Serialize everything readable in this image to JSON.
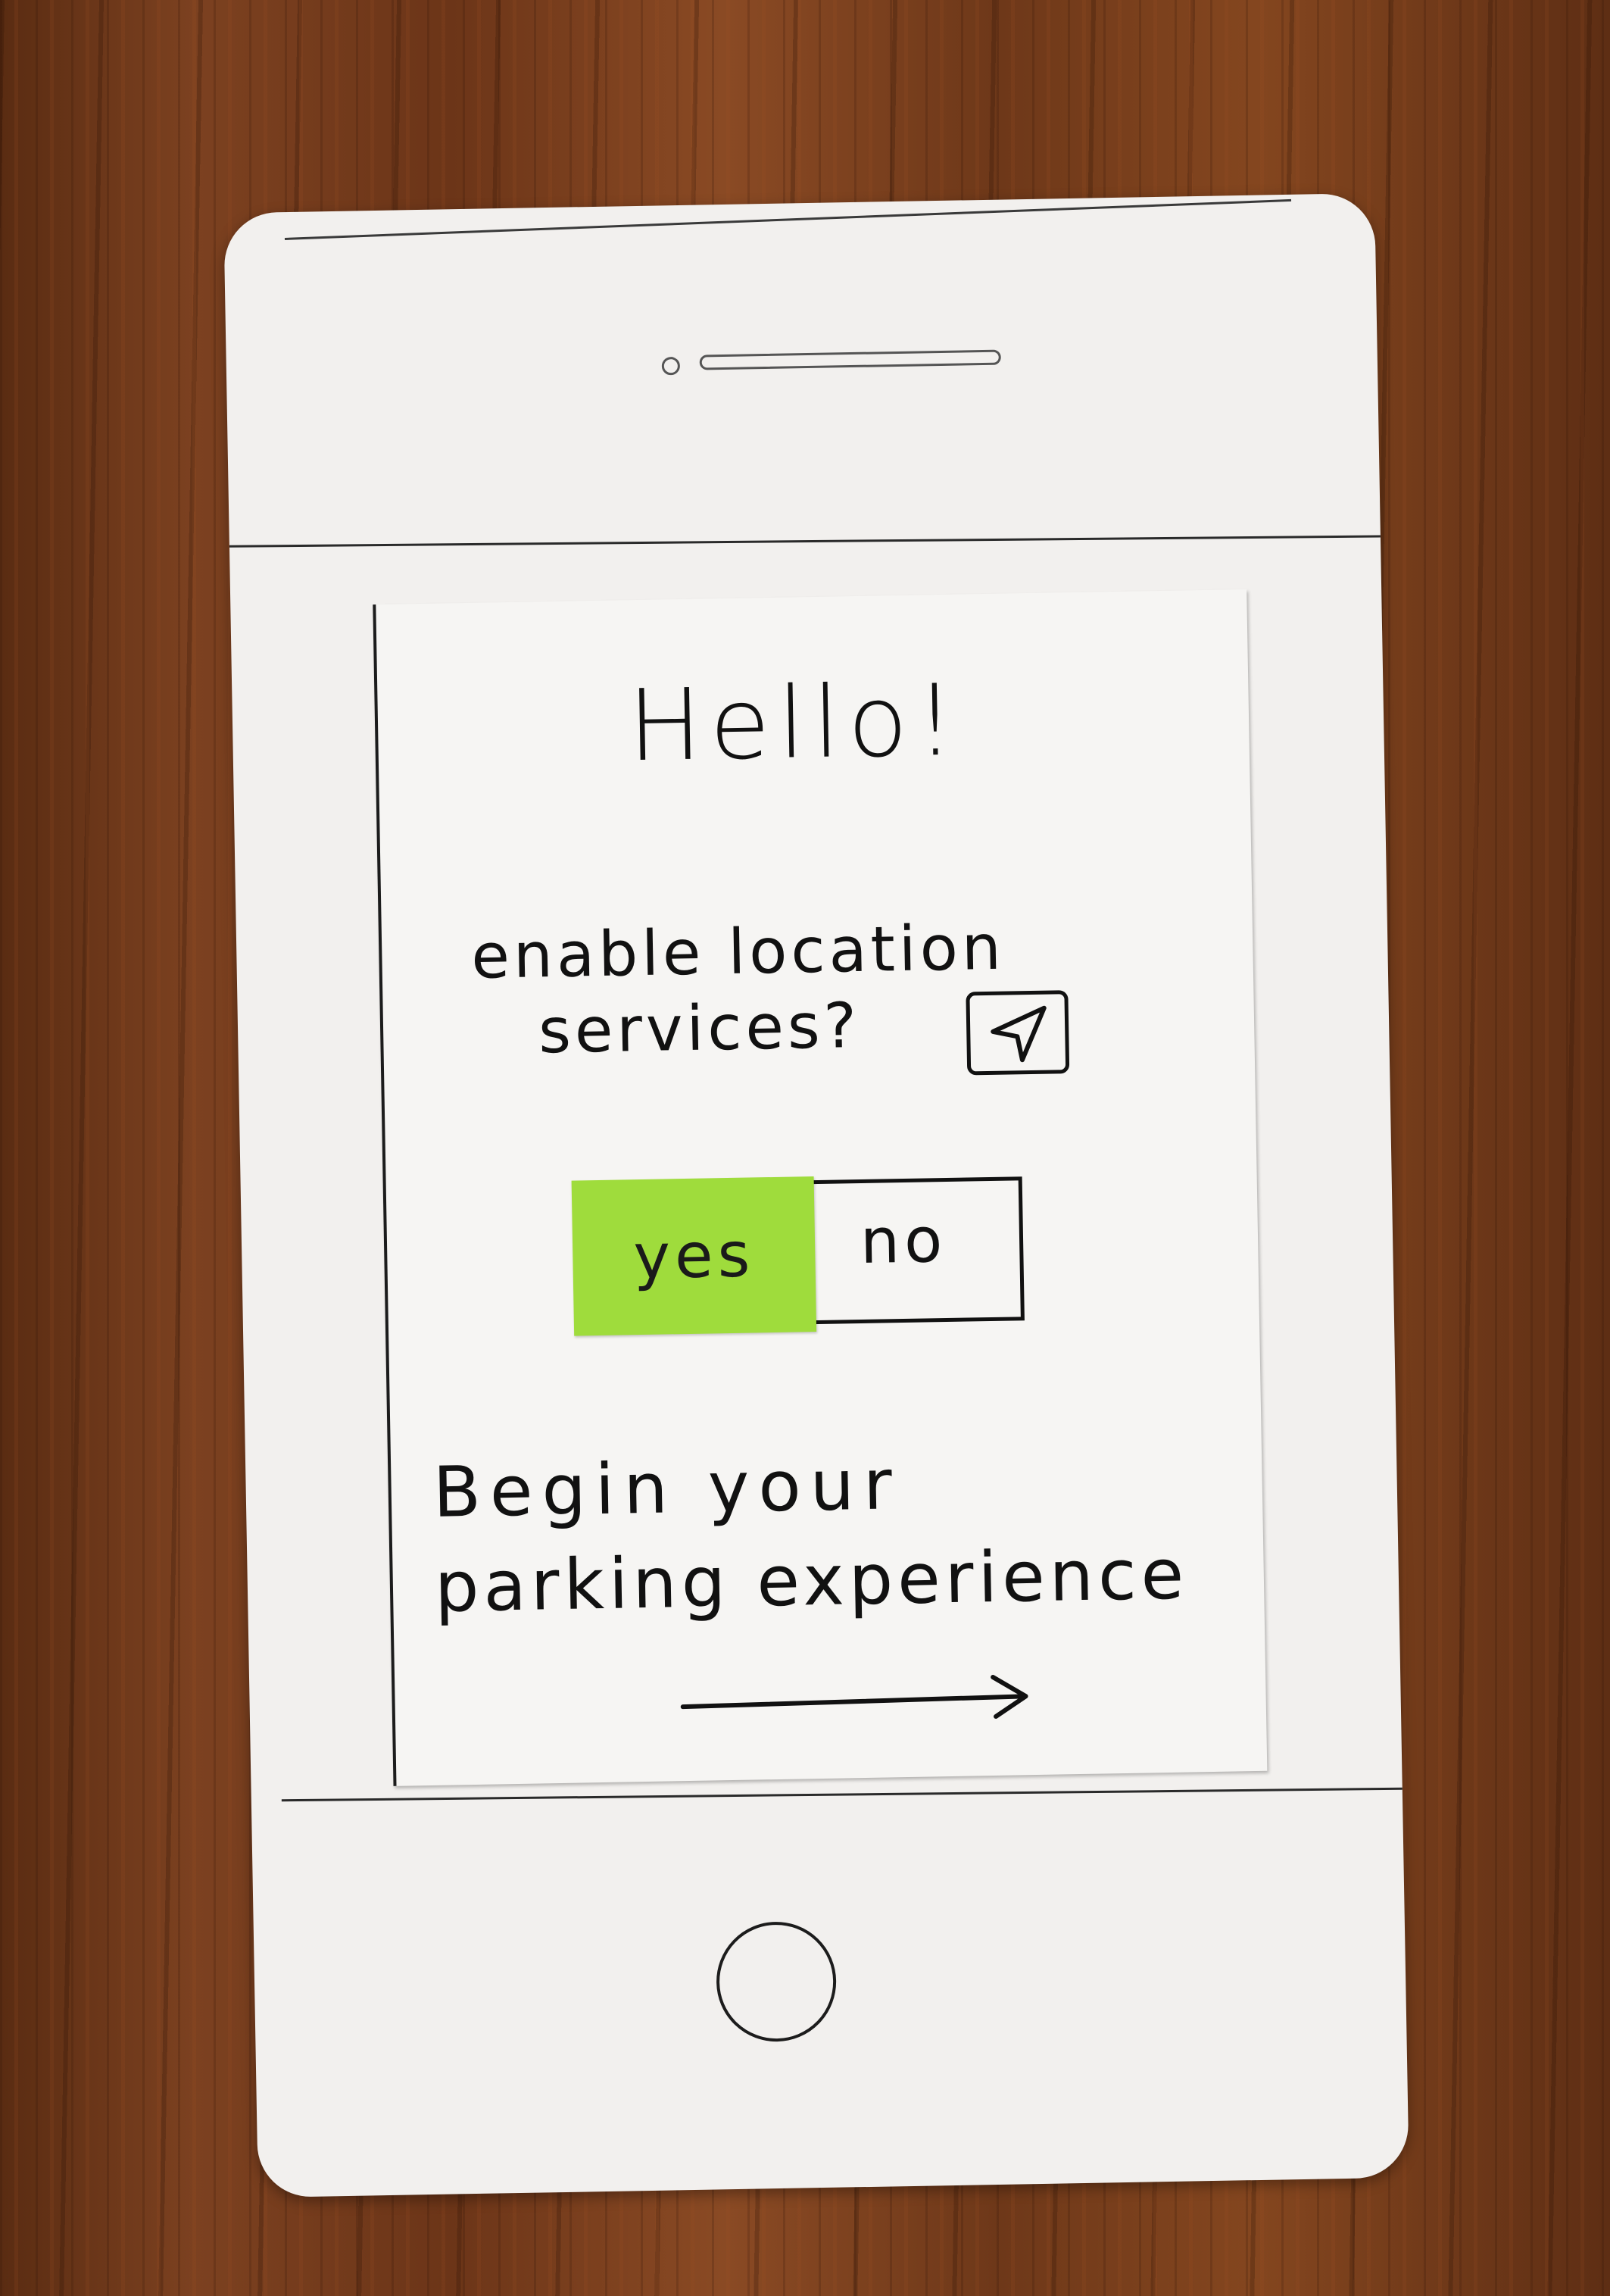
{
  "screen": {
    "greeting": "Hello!",
    "location_prompt": {
      "line1": "enable location",
      "line2": "services?",
      "icon": "location-arrow-icon"
    },
    "toggle": {
      "yes_label": "yes",
      "no_label": "no",
      "selected": "yes",
      "selected_color": "#9fdc3c"
    },
    "cta": {
      "line1": "Begin your",
      "line2": "parking experience",
      "icon": "arrow-right-icon"
    }
  },
  "device": {
    "home_button_icon": "home-button-circle"
  }
}
